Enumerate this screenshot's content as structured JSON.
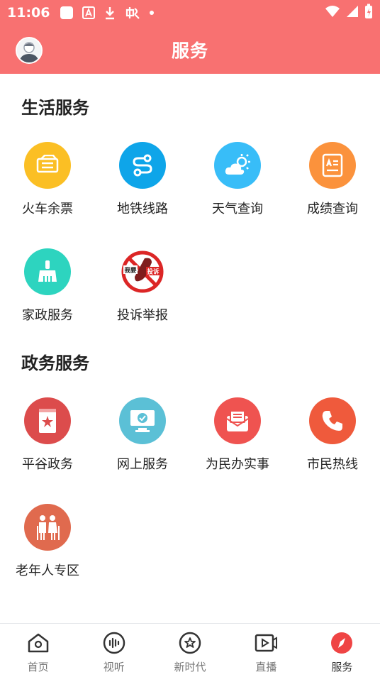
{
  "status": {
    "time": "11:06"
  },
  "header": {
    "title": "服务"
  },
  "sections": [
    {
      "title": "生活服务",
      "items": [
        {
          "label": "火车余票",
          "icon": "train-ticket-icon",
          "color": "#fbbf24"
        },
        {
          "label": "地铁线路",
          "icon": "subway-route-icon",
          "color": "#0ea5e9"
        },
        {
          "label": "天气查询",
          "icon": "weather-icon",
          "color": "#38bdf8"
        },
        {
          "label": "成绩查询",
          "icon": "score-card-icon",
          "color": "#fb923c"
        },
        {
          "label": "家政服务",
          "icon": "broom-icon",
          "color": "#2dd4bf"
        },
        {
          "label": "投诉举报",
          "icon": "complaint-phone-icon",
          "color": "#ef4444",
          "badge_text": [
            "我要",
            "投诉"
          ]
        }
      ]
    },
    {
      "title": "政务服务",
      "items": [
        {
          "label": "平谷政务",
          "icon": "bookmark-star-icon",
          "color": "#dc4c4c"
        },
        {
          "label": "网上服务",
          "icon": "monitor-check-icon",
          "color": "#5bc0d6"
        },
        {
          "label": "为民办实事",
          "icon": "mail-box-icon",
          "color": "#ef5350"
        },
        {
          "label": "市民热线",
          "icon": "phone-icon",
          "color": "#ef5a3c"
        },
        {
          "label": "老年人专区",
          "icon": "elderly-couple-icon",
          "color": "#e06a4e"
        }
      ]
    }
  ],
  "tabs": [
    {
      "label": "首页",
      "icon": "home-icon"
    },
    {
      "label": "视听",
      "icon": "audio-wave-icon"
    },
    {
      "label": "新时代",
      "icon": "star-badge-icon"
    },
    {
      "label": "直播",
      "icon": "live-video-icon"
    },
    {
      "label": "服务",
      "icon": "service-compass-icon",
      "active": true
    }
  ]
}
